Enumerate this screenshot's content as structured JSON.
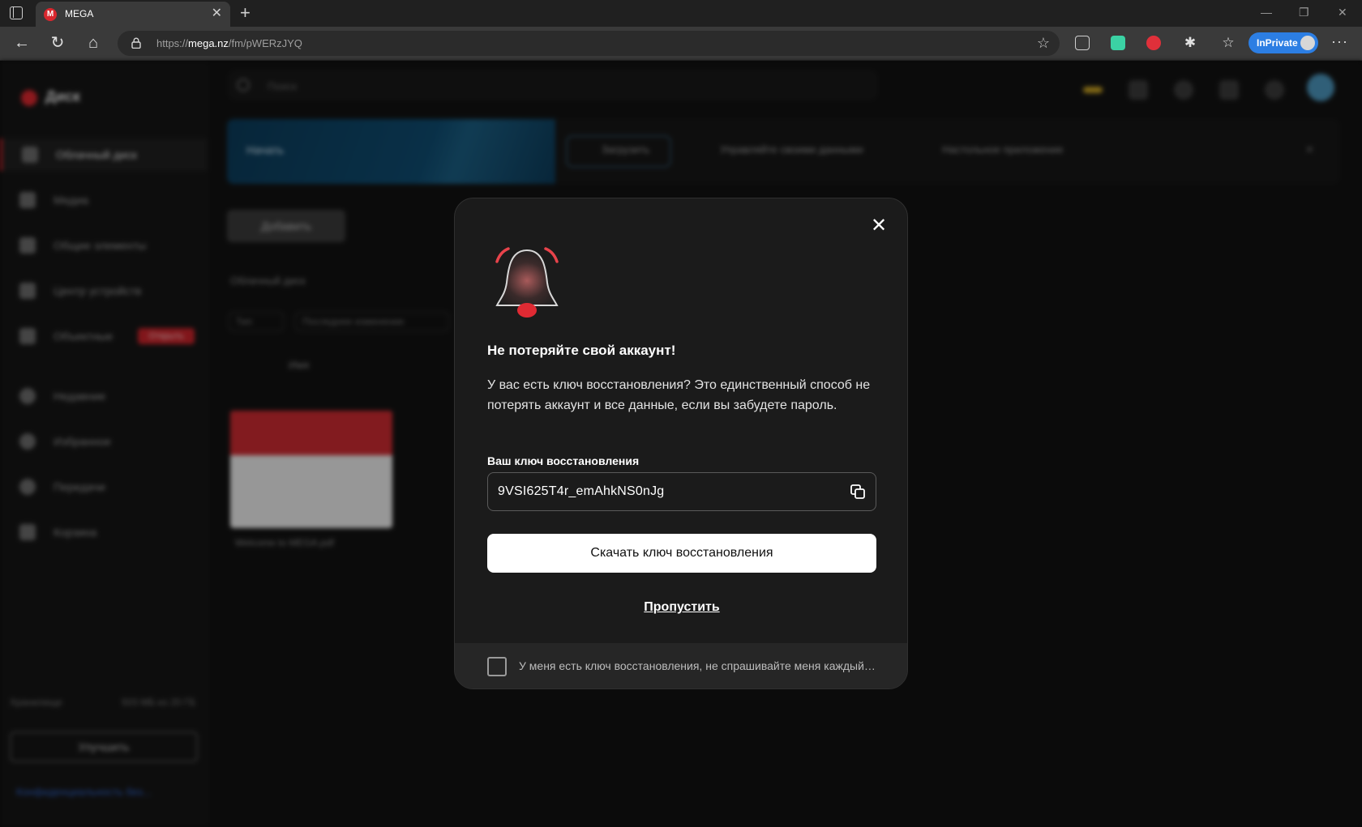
{
  "browser": {
    "tab_title": "MEGA",
    "favicon_letter": "M",
    "url_prefix": "https://",
    "url_domain": "mega.nz",
    "url_path": "/fm/pWERzJYQ",
    "inprivate_label": "InPrivate"
  },
  "app": {
    "brand": "Диск",
    "sidebar": [
      {
        "label": "Облачный диск",
        "active": true
      },
      {
        "label": "Медиа"
      },
      {
        "label": "Общие элементы"
      },
      {
        "label": "Центр устройств"
      },
      {
        "label": "Объектные",
        "badge": "Открыть"
      },
      {
        "label": "Недавние"
      },
      {
        "label": "Избранное"
      },
      {
        "label": "Передачи"
      },
      {
        "label": "Корзина"
      }
    ],
    "storage_label": "Хранилище",
    "storage_value": "503 МБ из 20 ГБ",
    "upgrade_label": "Улучшить",
    "promo_link": "Конфиденциальность без...",
    "search_placeholder": "Поиск",
    "banner_title": "Начать",
    "banner_steps": [
      "Загрузить",
      "Управляйте своими данными",
      "Настольное приложение"
    ],
    "add_button": "Добавить",
    "breadcrumb": "Облачный диск",
    "filters": [
      "Тип",
      "Последнее изменение"
    ],
    "list_header": "Имя",
    "file_name": "Welcome to MEGA.pdf"
  },
  "dialog": {
    "title": "Не потеряйте свой аккаунт!",
    "text": "У вас есть ключ восстановления? Это единственный способ не потерять аккаунт и все данные, если вы забудете пароль.",
    "key_label": "Ваш ключ восстановления",
    "key_value": "9VSI625T4r_emAhkNS0nJg",
    "download_button": "Скачать ключ восстановления",
    "skip_link": "Пропустить",
    "checkbox_label": "У меня есть ключ восстановления, не спрашивайте меня каждый раз",
    "checkbox_checked": false
  },
  "colors": {
    "accent": "#d9272e",
    "dialog_bg": "#1b1b1b",
    "footer_bg": "#262626",
    "inprivate": "#2c7ee3"
  }
}
